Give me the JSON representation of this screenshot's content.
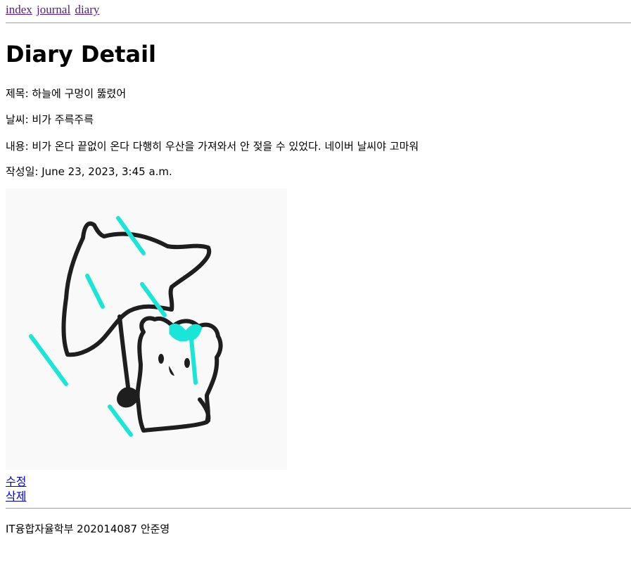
{
  "nav": {
    "links": [
      "index",
      "journal",
      "diary"
    ]
  },
  "page": {
    "title": "Diary Detail"
  },
  "diary": {
    "title_line": "제목: 하늘에 구멍이 뚫렸어",
    "weather_line": "날씨: 비가 주륵주륵",
    "content_line": "내용: 비가 온다 끝없이 온다 다행히 우산을 가져와서 안 젖을 수 있었다. 네이버 날씨야 고마워",
    "date_line": "작성일: June 23, 2023, 3:45 a.m."
  },
  "image": {
    "subject": "bear-with-umbrella-in-rain illustration"
  },
  "actions": {
    "edit": "수정",
    "delete": "삭제"
  },
  "footer": {
    "text": "IT융합자율학부 202014087 안준영"
  },
  "colors": {
    "link_visited": "#551a8b",
    "link": "#0000ee",
    "rain": "#19e6d7"
  }
}
